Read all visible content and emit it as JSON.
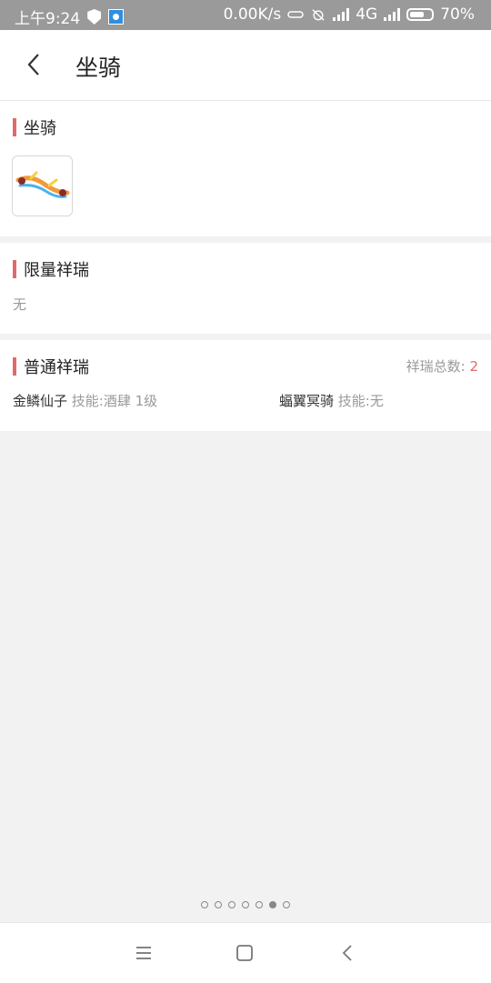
{
  "status_bar": {
    "time": "上午9:24",
    "net_speed": "0.00K/s",
    "network": "4G",
    "battery": "70%",
    "battery_level": 0.7
  },
  "header": {
    "title": "坐骑",
    "back_icon": "chevron-left-icon"
  },
  "mount_section": {
    "title": "坐骑",
    "image_icon": "mount-thumbnail"
  },
  "limited_section": {
    "title": "限量祥瑞",
    "empty_text": "无"
  },
  "normal_section": {
    "title": "普通祥瑞",
    "total_label": "祥瑞总数:",
    "total_count": "2",
    "items": [
      {
        "name": "金鳞仙子",
        "skill_label": "技能:",
        "skill_value": "酒肆 1级"
      },
      {
        "name": "蝠翼冥骑",
        "skill_label": "技能:",
        "skill_value": "无"
      }
    ]
  },
  "pager": {
    "count": 7,
    "active_index": 5
  },
  "system_nav": {
    "icons": [
      "menu-icon",
      "home-icon",
      "back-icon"
    ]
  },
  "colors": {
    "accent": "#e06b6b",
    "status_bar": "#9a9a9a",
    "background": "#f2f2f2"
  }
}
